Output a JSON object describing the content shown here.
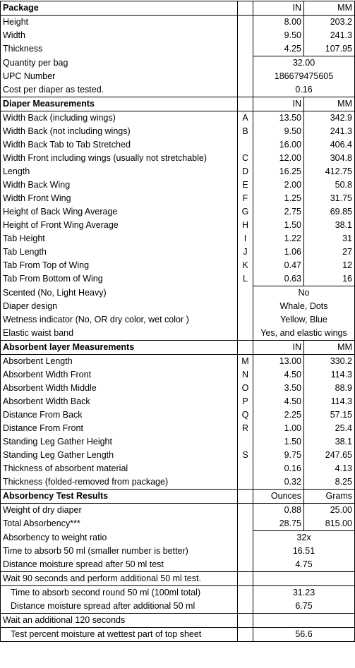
{
  "sections": [
    {
      "title": "Package",
      "col1": "IN",
      "col2": "MM",
      "rows": [
        {
          "label": "Height",
          "letter": "",
          "in": "8.00",
          "mm": "203.2"
        },
        {
          "label": "Width",
          "letter": "",
          "in": "9.50",
          "mm": "241.3"
        },
        {
          "label": "Thickness",
          "letter": "",
          "in": "4.25",
          "mm": "107.95"
        }
      ],
      "merged_rows": [
        {
          "label": "Quantity per bag",
          "value": "32.00"
        },
        {
          "label": "UPC Number",
          "value": "186679475605"
        },
        {
          "label": "Cost per diaper as tested.",
          "value": "0.16"
        }
      ]
    },
    {
      "title": "Diaper Measurements",
      "col1": "IN",
      "col2": "MM",
      "rows": [
        {
          "label": "Width Back (including wings)",
          "letter": "A",
          "in": "13.50",
          "mm": "342.9"
        },
        {
          "label": "Width Back (not including wings)",
          "letter": "B",
          "in": "9.50",
          "mm": "241.3"
        },
        {
          "label": "Width Back Tab to Tab Stretched",
          "letter": "",
          "in": "16.00",
          "mm": "406.4"
        },
        {
          "label": "Width Front including wings (usually not stretchable)",
          "letter": "C",
          "in": "12.00",
          "mm": "304.8"
        },
        {
          "label": "Length",
          "letter": "D",
          "in": "16.25",
          "mm": "412.75"
        },
        {
          "label": "Width Back Wing",
          "letter": "E",
          "in": "2.00",
          "mm": "50.8"
        },
        {
          "label": "Width Front Wing",
          "letter": "F",
          "in": "1.25",
          "mm": "31.75"
        },
        {
          "label": "Height of Back Wing Average",
          "letter": "G",
          "in": "2.75",
          "mm": "69.85"
        },
        {
          "label": "Height of Front Wing Average",
          "letter": "H",
          "in": "1.50",
          "mm": "38.1"
        },
        {
          "label": "Tab Height",
          "letter": "I",
          "in": "1.22",
          "mm": "31"
        },
        {
          "label": "Tab Length",
          "letter": "J",
          "in": "1.06",
          "mm": "27"
        },
        {
          "label": "Tab From Top of Wing",
          "letter": "K",
          "in": "0.47",
          "mm": "12"
        },
        {
          "label": "Tab From Bottom of Wing",
          "letter": "L",
          "in": "0.63",
          "mm": "16"
        }
      ],
      "merged_rows": [
        {
          "label": "Scented (No, Light Heavy)",
          "value": "No"
        },
        {
          "label": "Diaper design",
          "value": "Whale, Dots"
        },
        {
          "label": "Wetness indicator (No, OR dry color, wet color )",
          "value": "Yellow, Blue"
        },
        {
          "label": "Elastic waist band",
          "value": "Yes, and elastic wings"
        }
      ]
    },
    {
      "title": "Absorbent layer Measurements",
      "col1": "IN",
      "col2": "MM",
      "rows": [
        {
          "label": "Absorbent Length",
          "letter": "M",
          "in": "13.00",
          "mm": "330.2"
        },
        {
          "label": "Absorbent Width Front",
          "letter": "N",
          "in": "4.50",
          "mm": "114.3"
        },
        {
          "label": "Absorbent Width Middle",
          "letter": "O",
          "in": "3.50",
          "mm": "88.9"
        },
        {
          "label": "Absorbent Width Back",
          "letter": "P",
          "in": "4.50",
          "mm": "114.3"
        },
        {
          "label": "Distance From Back",
          "letter": "Q",
          "in": "2.25",
          "mm": "57.15"
        },
        {
          "label": "Distance From Front",
          "letter": "R",
          "in": "1.00",
          "mm": "25.4"
        },
        {
          "label": "Standing Leg Gather Height",
          "letter": "",
          "in": "1.50",
          "mm": "38.1"
        },
        {
          "label": "Standing Leg Gather Length",
          "letter": "S",
          "in": "9.75",
          "mm": "247.65"
        },
        {
          "label": "Thickness of absorbent material",
          "letter": "",
          "in": "0.16",
          "mm": "4.13"
        },
        {
          "label": "Thickness (folded-removed from package)",
          "letter": "",
          "in": "0.32",
          "mm": "8.25"
        }
      ]
    },
    {
      "title": "Absorbency Test Results",
      "col1": "Ounces",
      "col2": "Grams",
      "rows": [
        {
          "label": "Weight of dry diaper",
          "letter": "",
          "in": "0.88",
          "mm": "25.00"
        },
        {
          "label": "Total Absorbency***",
          "letter": "",
          "in": "28.75",
          "mm": "815.00"
        }
      ],
      "merged_rows": [
        {
          "label": "Absorbency to weight ratio",
          "value": "32x"
        },
        {
          "label": "Time to absorb 50 ml (smaller number is better)",
          "value": "16.51"
        },
        {
          "label": "Distance moisture spread after 50 ml test",
          "value": "4.75"
        }
      ],
      "second_test": {
        "instruction": "Wait 90 seconds and perform additional 50 ml test.",
        "rows": [
          {
            "label": "Time to absorb second round 50 ml  (100ml total)",
            "value": "31.23"
          },
          {
            "label": "Distance moisture spread after additional 50 ml",
            "value": "6.75"
          }
        ]
      },
      "final_test": {
        "instruction": "Wait an additional 120 seconds",
        "rows": [
          {
            "label": "Test percent moisture at wettest part of top sheet",
            "value": "56.6"
          }
        ]
      }
    }
  ]
}
